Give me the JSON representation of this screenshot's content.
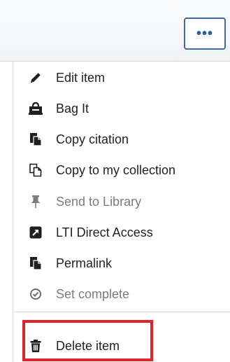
{
  "header": {
    "more_button_label": "•••"
  },
  "menu": {
    "items": [
      {
        "label": "Edit item",
        "icon": "pencil-icon"
      },
      {
        "label": "Bag It",
        "icon": "bag-icon"
      },
      {
        "label": "Copy citation",
        "icon": "copy-icon"
      },
      {
        "label": "Copy to my collection",
        "icon": "copy-outline-icon"
      },
      {
        "label": "Send to Library",
        "icon": "pin-icon"
      },
      {
        "label": "LTI Direct Access",
        "icon": "external-link-icon"
      },
      {
        "label": "Permalink",
        "icon": "permalink-icon"
      },
      {
        "label": "Set complete",
        "icon": "check-circle-icon"
      },
      {
        "label": "Delete item",
        "icon": "trash-icon"
      }
    ]
  },
  "colors": {
    "accent": "#3e6aa6",
    "highlight": "#e0232a",
    "disabled_text": "#7c7c7c"
  }
}
